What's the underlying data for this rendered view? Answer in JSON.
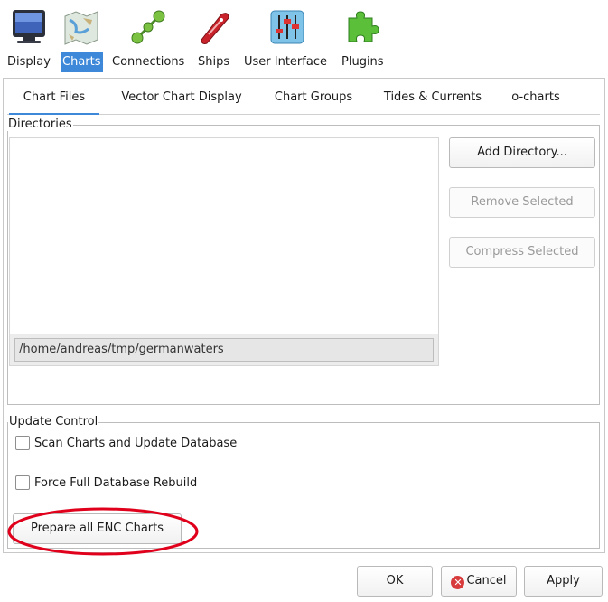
{
  "toolbar": {
    "items": [
      {
        "label": "Display",
        "icon": "monitor-icon"
      },
      {
        "label": "Charts",
        "icon": "chart-map-icon",
        "selected": true
      },
      {
        "label": "Connections",
        "icon": "connections-icon"
      },
      {
        "label": "Ships",
        "icon": "ship-icon"
      },
      {
        "label": "User Interface",
        "icon": "sliders-icon"
      },
      {
        "label": "Plugins",
        "icon": "puzzle-icon"
      }
    ]
  },
  "tabs": [
    {
      "label": "Chart Files",
      "active": true
    },
    {
      "label": "Vector Chart Display"
    },
    {
      "label": "Chart Groups"
    },
    {
      "label": "Tides & Currents"
    },
    {
      "label": "o-charts"
    }
  ],
  "directories": {
    "title": "Directories",
    "items": [
      "/home/andreas/tmp/germanwaters"
    ],
    "add_label": "Add Directory...",
    "remove_label": "Remove Selected",
    "compress_label": "Compress Selected"
  },
  "update_control": {
    "title": "Update Control",
    "scan_label": "Scan Charts and Update Database",
    "scan_checked": false,
    "force_label": "Force Full Database Rebuild",
    "force_checked": false,
    "prepare_label": "Prepare all ENC Charts"
  },
  "footer": {
    "ok_label": "OK",
    "cancel_label": "Cancel",
    "apply_label": "Apply"
  },
  "colors": {
    "accent": "#3d88d9",
    "annotation": "#e0001b"
  }
}
